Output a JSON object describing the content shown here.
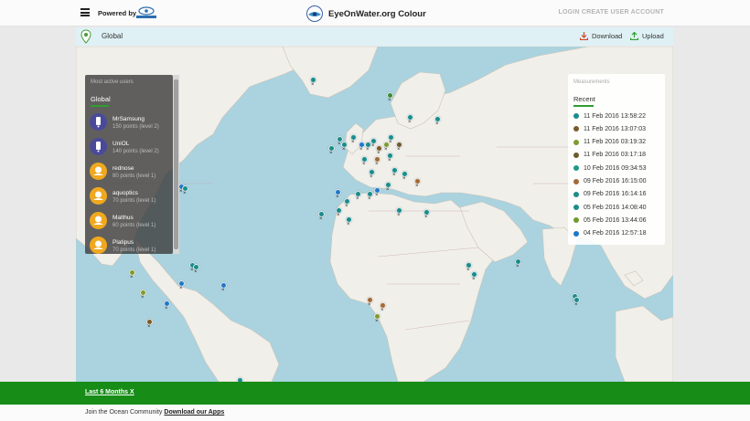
{
  "header": {
    "powered_by": "Powered by",
    "partner_logo_text": "CITCLOPS",
    "app_title": "EyeOnWater.org Colour",
    "login": "LOGIN",
    "create_account": "CREATE USER ACCOUNT"
  },
  "subbar": {
    "scope_title": "Global",
    "download": "Download",
    "upload": "Upload"
  },
  "users_panel": {
    "title": "Most active users",
    "tab": "Global",
    "users": [
      {
        "name": "MrSamsung",
        "points": "150 points (level 2)",
        "avatar": "phone-avatar"
      },
      {
        "name": "UniOL",
        "points": "140 points (level 2)",
        "avatar": "phone-avatar"
      },
      {
        "name": "rednose",
        "points": "80 points (level 1)",
        "avatar": "duck-avatar"
      },
      {
        "name": "aquoptics",
        "points": "70 points (level 1)",
        "avatar": "duck-avatar"
      },
      {
        "name": "Malthus",
        "points": "60 points (level 1)",
        "avatar": "duck-avatar"
      },
      {
        "name": "Platipus",
        "points": "70 points (level 1)",
        "avatar": "duck-avatar"
      }
    ]
  },
  "measurements_panel": {
    "title": "Measurements",
    "tab": "Recent",
    "items": [
      {
        "date": "11 Feb 2016 13:58:22",
        "color": "#1c8c8c"
      },
      {
        "date": "11 Feb 2016 13:07:03",
        "color": "#7a5a2c"
      },
      {
        "date": "11 Feb 2016 03:19:32",
        "color": "#7f9a32"
      },
      {
        "date": "11 Feb 2016 03:17:18",
        "color": "#6b5a2e"
      },
      {
        "date": "10 Feb 2016 09:34:53",
        "color": "#1b9a86"
      },
      {
        "date": "09 Feb 2016 16:15:00",
        "color": "#a06a36"
      },
      {
        "date": "09 Feb 2016 16:14:16",
        "color": "#1b8e86"
      },
      {
        "date": "05 Feb 2016 14:08:40",
        "color": "#1b8c8c"
      },
      {
        "date": "05 Feb 2016 13:44:06",
        "color": "#6f9a2f"
      },
      {
        "date": "04 Feb 2016 12:57:18",
        "color": "#1e78c8"
      }
    ]
  },
  "filter_bar": {
    "period": "Last 6 Months X"
  },
  "footer": {
    "text": "Join the Ocean Community",
    "link": "Download our Apps"
  },
  "colors": {
    "accent_green": "#178c17",
    "water": "#aad3df",
    "land": "#f1efe9"
  }
}
